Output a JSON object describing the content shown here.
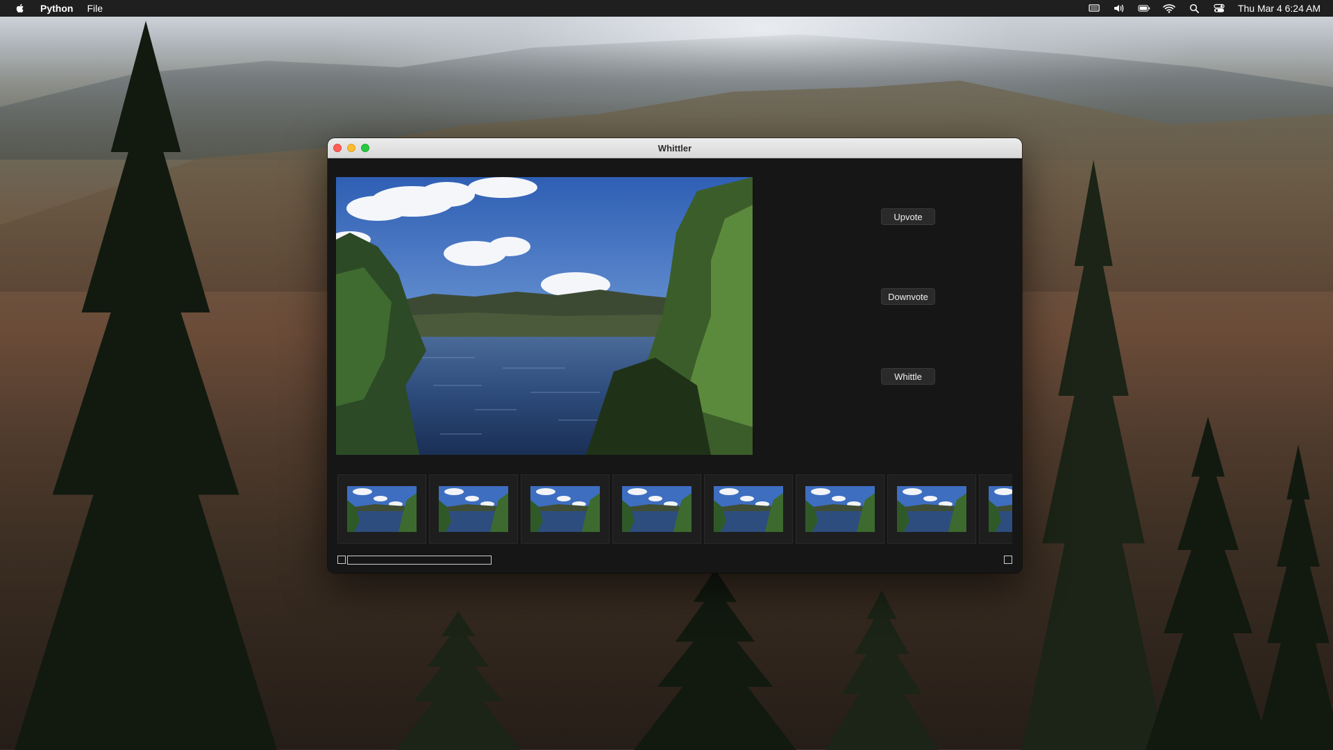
{
  "menubar": {
    "apple_icon": "apple-logo-icon",
    "app_name": "Python",
    "menus": [
      "File"
    ],
    "status_icons": [
      "stage-manager-icon",
      "volume-icon",
      "battery-icon",
      "wifi-icon",
      "spotlight-search-icon",
      "control-center-icon"
    ],
    "datetime": "Thu Mar 4  6:24 AM"
  },
  "window": {
    "title": "Whittler",
    "buttons": {
      "upvote": "Upvote",
      "downvote": "Downvote",
      "whittle": "Whittle"
    },
    "thumbnail_count": 8
  }
}
